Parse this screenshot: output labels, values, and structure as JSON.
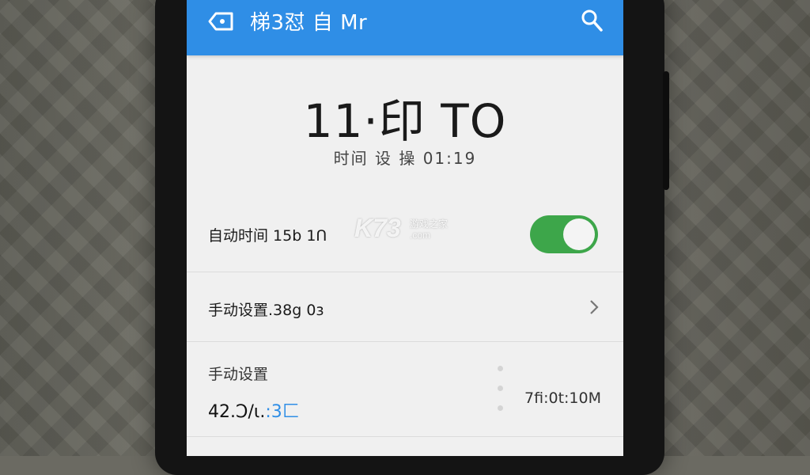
{
  "appbar": {
    "title": "梯3怼 自 Mr",
    "back_icon": "tag-back-icon",
    "search_icon": "search-icon"
  },
  "clock": {
    "time": "11·印 TO",
    "subtitle": "时间 设 操 01:19"
  },
  "watermark": {
    "brand": "K73",
    "tagline": "游戏之家",
    "domain": ".com"
  },
  "settings": {
    "auto_time": {
      "label": "自动时间 15b 1Ո",
      "enabled": true
    },
    "manual_setting": {
      "label": "手动设置.38g 0ɜ"
    },
    "manual_section": {
      "label": "手动设置",
      "value_main": "42.Ͻ/ι.",
      "value_accent": ":3匚",
      "right_value": "7fi:0t:10M"
    }
  },
  "colors": {
    "appbar": "#2f8ee6",
    "toggle_on": "#3da64a",
    "screen_bg": "#f0f0f0"
  }
}
